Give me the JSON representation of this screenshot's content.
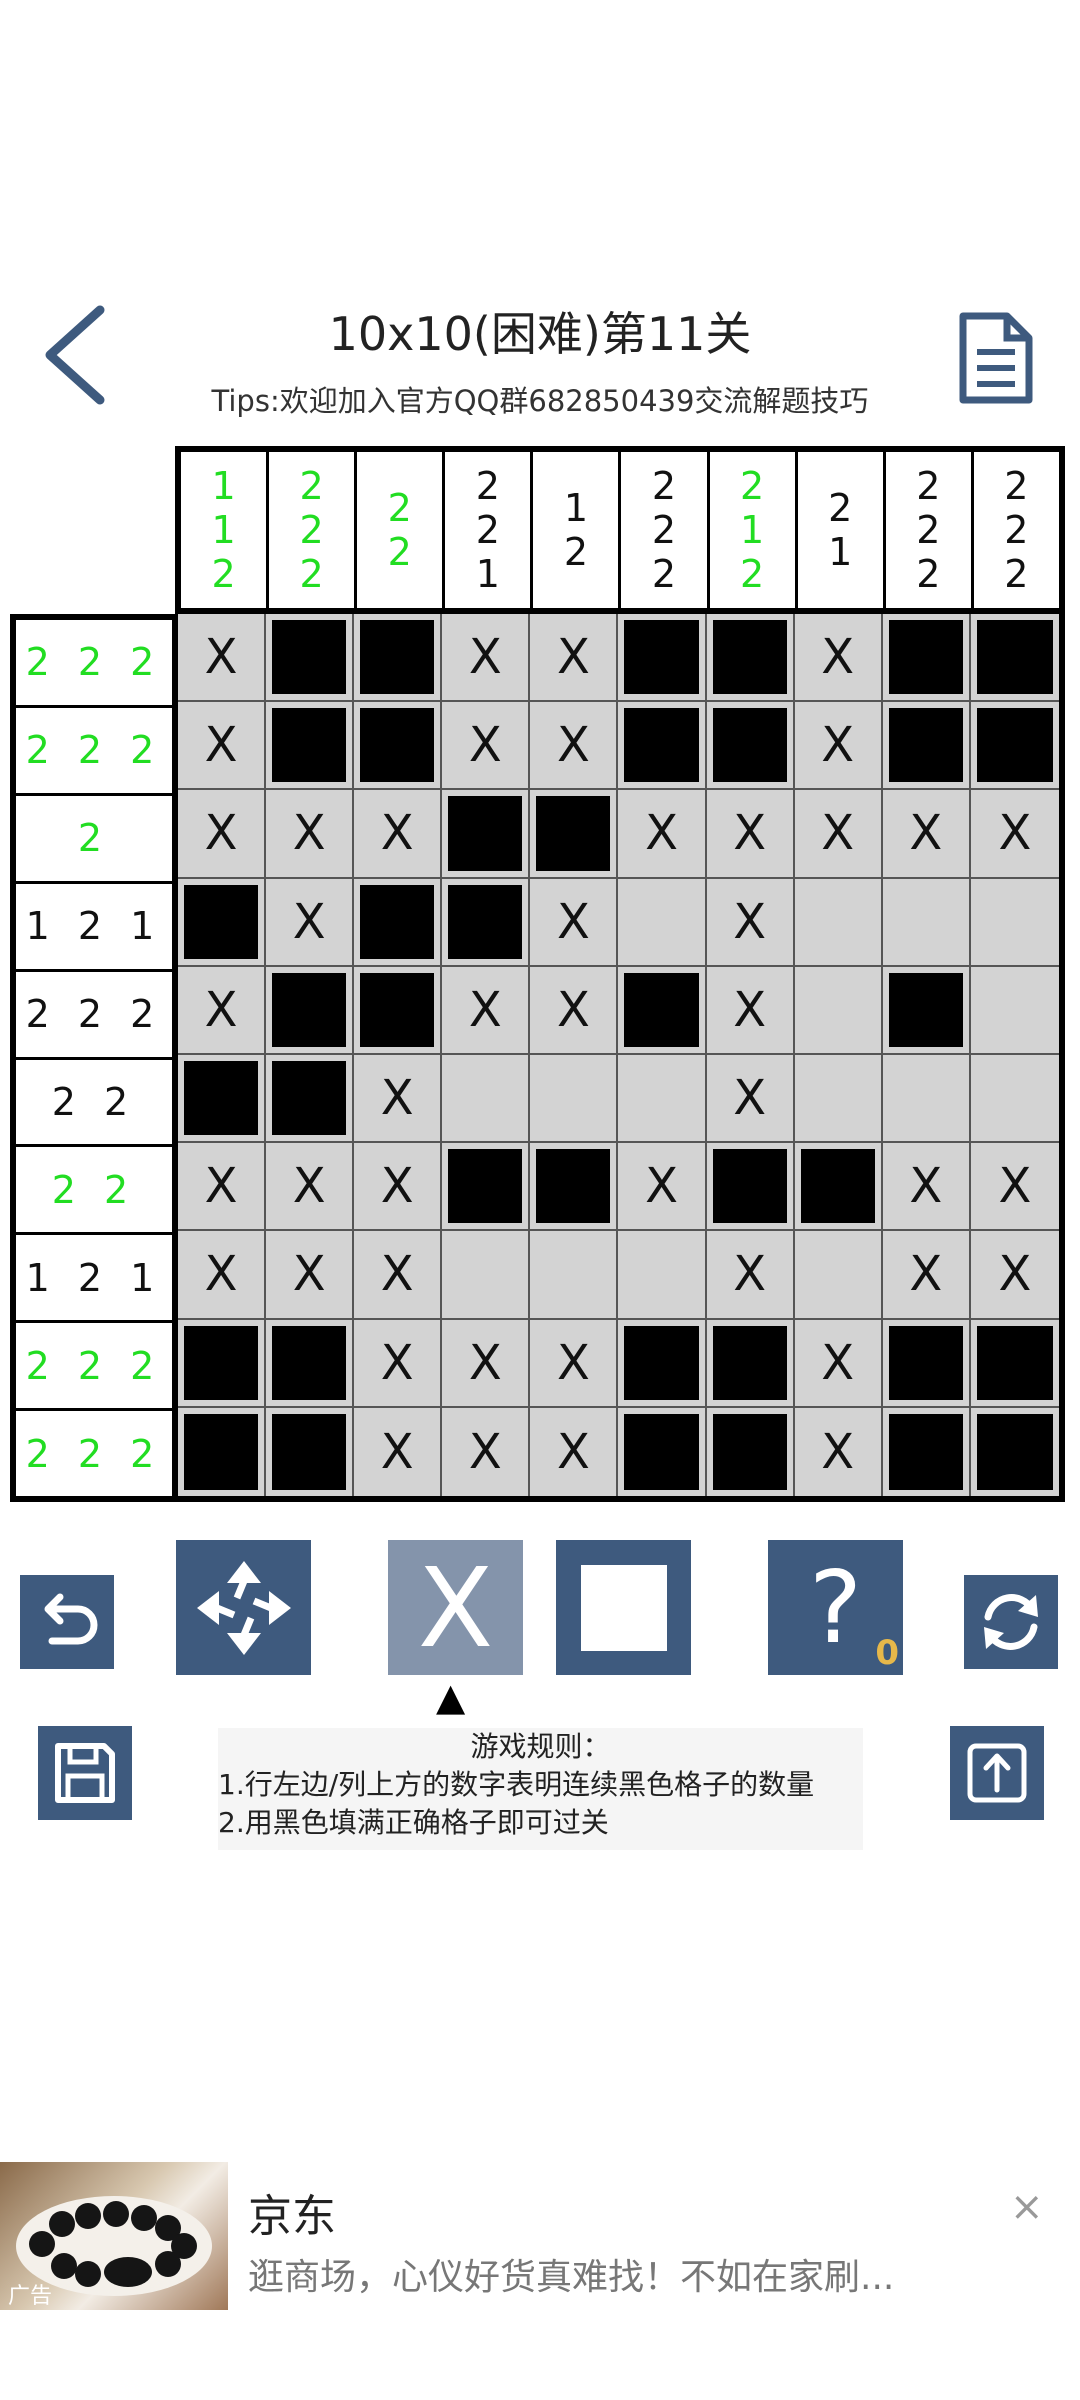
{
  "header": {
    "title": "10x10(困难)第11关",
    "tips": "Tips:欢迎加入官方QQ群682850439交流解题技巧",
    "back_icon": "back-arrow-icon",
    "doc_icon": "document-icon"
  },
  "colors": {
    "clue_done": "#22dd22",
    "clue_pending": "#111111",
    "tool_bg": "#3e5a7e",
    "tool_active_bg": "#8494ab",
    "grid_bg": "#d3d3d3",
    "hint_badge": "#e7b84a"
  },
  "board": {
    "col_clues": [
      {
        "nums": [
          "1",
          "1",
          "2"
        ],
        "done": true
      },
      {
        "nums": [
          "2",
          "2",
          "2"
        ],
        "done": true
      },
      {
        "nums": [
          "2",
          "2"
        ],
        "done": true
      },
      {
        "nums": [
          "2",
          "2",
          "1"
        ],
        "done": false
      },
      {
        "nums": [
          "1",
          "2"
        ],
        "done": false
      },
      {
        "nums": [
          "2",
          "2",
          "2"
        ],
        "done": false
      },
      {
        "nums": [
          "2",
          "1",
          "2"
        ],
        "done": true
      },
      {
        "nums": [
          "2",
          "1"
        ],
        "done": false
      },
      {
        "nums": [
          "2",
          "2",
          "2"
        ],
        "done": false
      },
      {
        "nums": [
          "2",
          "2",
          "2"
        ],
        "done": false
      }
    ],
    "row_clues": [
      {
        "text": "2 2 2",
        "done": true
      },
      {
        "text": "2 2 2",
        "done": true
      },
      {
        "text": "2",
        "done": true
      },
      {
        "text": "1 2 1",
        "done": false
      },
      {
        "text": "2 2 2",
        "done": false
      },
      {
        "text": "2 2",
        "done": false
      },
      {
        "text": "2 2",
        "done": true
      },
      {
        "text": "1 2 1",
        "done": false
      },
      {
        "text": "2 2 2",
        "done": true
      },
      {
        "text": "2 2 2",
        "done": true
      }
    ],
    "cells": [
      [
        "X",
        "B",
        "B",
        "X",
        "X",
        "B",
        "B",
        "X",
        "B",
        "B"
      ],
      [
        "X",
        "B",
        "B",
        "X",
        "X",
        "B",
        "B",
        "X",
        "B",
        "B"
      ],
      [
        "X",
        "X",
        "X",
        "B",
        "B",
        "X",
        "X",
        "X",
        "X",
        "X"
      ],
      [
        "B",
        "X",
        "B",
        "B",
        "X",
        "",
        "X",
        "",
        "",
        ""
      ],
      [
        "X",
        "B",
        "B",
        "X",
        "X",
        "B",
        "X",
        "",
        "B",
        ""
      ],
      [
        "B",
        "B",
        "X",
        "",
        "",
        "",
        "X",
        "",
        "",
        ""
      ],
      [
        "X",
        "X",
        "X",
        "B",
        "B",
        "X",
        "B",
        "B",
        "X",
        "X"
      ],
      [
        "X",
        "X",
        "X",
        "",
        "",
        "",
        "X",
        "",
        "X",
        "X"
      ],
      [
        "B",
        "B",
        "X",
        "X",
        "X",
        "B",
        "B",
        "X",
        "B",
        "B"
      ],
      [
        "B",
        "B",
        "X",
        "X",
        "X",
        "B",
        "B",
        "X",
        "B",
        "B"
      ]
    ],
    "cross_mark": "X"
  },
  "toolbar": {
    "undo_icon": "undo-icon",
    "move_icon": "move-arrows-icon",
    "cross_label": "X",
    "fill_icon": "fill-square-icon",
    "hint_label": "?",
    "hint_count": "0",
    "refresh_icon": "refresh-icon",
    "mode_indicator": "▲",
    "save_icon": "save-icon",
    "share_icon": "share-upload-icon"
  },
  "rules": {
    "title": "游戏规则：",
    "line1": "1.行左边/列上方的数字表明连续黑色格子的数量",
    "line2": "2.用黑色填满正确格子即可过关"
  },
  "ad": {
    "title": "京东",
    "description": "逛商场，心仪好货真难找！不如在家刷...",
    "close": "×",
    "tag": "广告"
  }
}
